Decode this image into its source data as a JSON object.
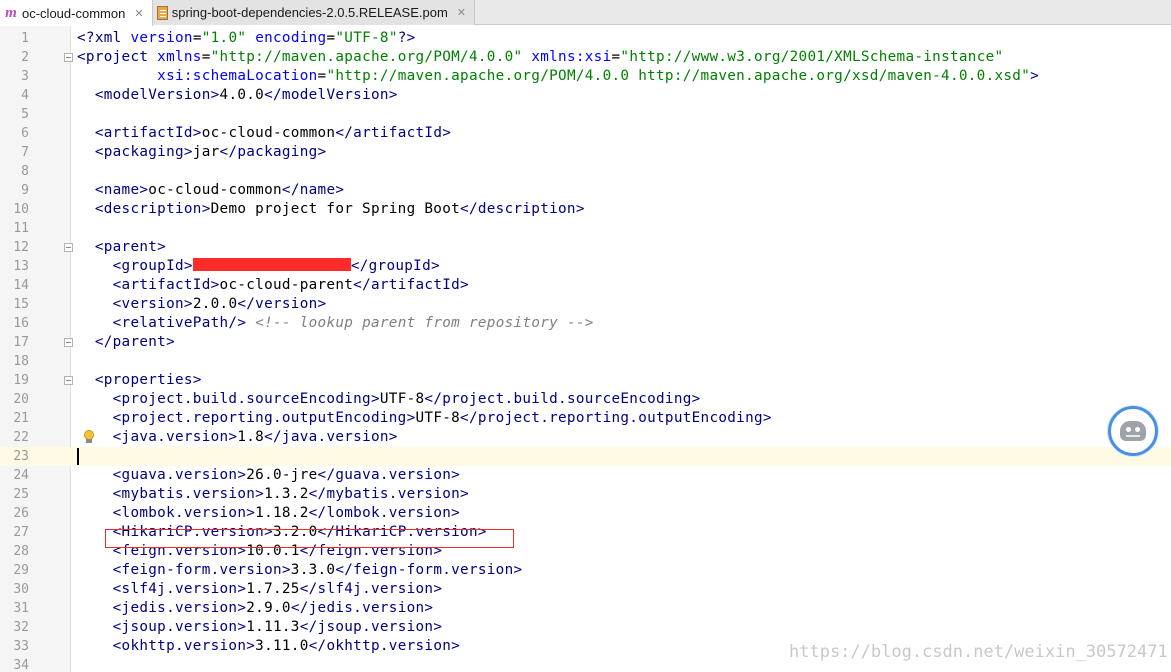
{
  "tabs": [
    {
      "label": "oc-cloud-common",
      "icon": "maven-module-icon",
      "active": true
    },
    {
      "label": "spring-boot-dependencies-2.0.5.RELEASE.pom",
      "icon": "pom-file-icon",
      "active": false
    }
  ],
  "editor": {
    "current_line": 23,
    "highlighted_line": 26,
    "lines": [
      {
        "n": "1",
        "parts": [
          [
            "tag",
            "<?xml "
          ],
          [
            "an",
            "version"
          ],
          [
            "",
            "="
          ],
          [
            "av",
            "\"1.0\""
          ],
          [
            "an",
            " encoding"
          ],
          [
            "",
            "="
          ],
          [
            "av",
            "\"UTF-8\""
          ],
          [
            "tag",
            "?>"
          ]
        ]
      },
      {
        "n": "2",
        "parts": [
          [
            "tag",
            "<project "
          ],
          [
            "an",
            "xmlns"
          ],
          [
            "",
            "="
          ],
          [
            "av",
            "\"http://maven.apache.org/POM/4.0.0\""
          ],
          [
            "an",
            " xmlns:xsi"
          ],
          [
            "",
            "="
          ],
          [
            "av",
            "\"http://www.w3.org/2001/XMLSchema-instance\""
          ]
        ]
      },
      {
        "n": "3",
        "parts": [
          [
            "",
            "         "
          ],
          [
            "an",
            "xsi:schemaLocation"
          ],
          [
            "",
            "="
          ],
          [
            "av",
            "\"http://maven.apache.org/POM/4.0.0 http://maven.apache.org/xsd/maven-4.0.0.xsd\""
          ],
          [
            "tag",
            ">"
          ]
        ]
      },
      {
        "n": "4",
        "parts": [
          [
            "",
            "  "
          ],
          [
            "tag",
            "<modelVersion>"
          ],
          [
            "",
            "4.0.0"
          ],
          [
            "tag",
            "</modelVersion>"
          ]
        ]
      },
      {
        "n": "5",
        "parts": []
      },
      {
        "n": "6",
        "parts": [
          [
            "",
            "  "
          ],
          [
            "tag",
            "<artifactId>"
          ],
          [
            "",
            "oc-cloud-common"
          ],
          [
            "tag",
            "</artifactId>"
          ]
        ]
      },
      {
        "n": "7",
        "parts": [
          [
            "",
            "  "
          ],
          [
            "tag",
            "<packaging>"
          ],
          [
            "",
            "jar"
          ],
          [
            "tag",
            "</packaging>"
          ]
        ]
      },
      {
        "n": "8",
        "parts": []
      },
      {
        "n": "9",
        "parts": [
          [
            "",
            "  "
          ],
          [
            "tag",
            "<name>"
          ],
          [
            "",
            "oc-cloud-common"
          ],
          [
            "tag",
            "</name>"
          ]
        ]
      },
      {
        "n": "10",
        "parts": [
          [
            "",
            "  "
          ],
          [
            "tag",
            "<description>"
          ],
          [
            "",
            "Demo project for Spring Boot"
          ],
          [
            "tag",
            "</description>"
          ]
        ]
      },
      {
        "n": "11",
        "parts": []
      },
      {
        "n": "12",
        "parts": [
          [
            "",
            "  "
          ],
          [
            "tag",
            "<parent>"
          ]
        ]
      },
      {
        "n": "13",
        "parts": [
          [
            "",
            "    "
          ],
          [
            "tag",
            "<groupId>"
          ],
          [
            "redact",
            ""
          ],
          [
            "tag",
            "</groupId>"
          ]
        ]
      },
      {
        "n": "14",
        "parts": [
          [
            "",
            "    "
          ],
          [
            "tag",
            "<artifactId>"
          ],
          [
            "",
            "oc-cloud-parent"
          ],
          [
            "tag",
            "</artifactId>"
          ]
        ]
      },
      {
        "n": "15",
        "parts": [
          [
            "",
            "    "
          ],
          [
            "tag",
            "<version>"
          ],
          [
            "",
            "2.0.0"
          ],
          [
            "tag",
            "</version>"
          ]
        ]
      },
      {
        "n": "16",
        "parts": [
          [
            "",
            "    "
          ],
          [
            "tag",
            "<relativePath/>"
          ],
          [
            "",
            " "
          ],
          [
            "cm",
            "<!-- lookup parent from repository -->"
          ]
        ]
      },
      {
        "n": "17",
        "parts": [
          [
            "",
            "  "
          ],
          [
            "tag",
            "</parent>"
          ]
        ]
      },
      {
        "n": "18",
        "parts": []
      },
      {
        "n": "19",
        "parts": [
          [
            "",
            "  "
          ],
          [
            "tag",
            "<properties>"
          ]
        ]
      },
      {
        "n": "20",
        "parts": [
          [
            "",
            "    "
          ],
          [
            "tag",
            "<project.build.sourceEncoding>"
          ],
          [
            "",
            "UTF-8"
          ],
          [
            "tag",
            "</project.build.sourceEncoding>"
          ]
        ]
      },
      {
        "n": "21",
        "parts": [
          [
            "",
            "    "
          ],
          [
            "tag",
            "<project.reporting.outputEncoding>"
          ],
          [
            "",
            "UTF-8"
          ],
          [
            "tag",
            "</project.reporting.outputEncoding>"
          ]
        ]
      },
      {
        "n": "22",
        "parts": [
          [
            "",
            "    "
          ],
          [
            "tag",
            "<java.version>"
          ],
          [
            "",
            "1.8"
          ],
          [
            "tag",
            "</java.version>"
          ]
        ]
      },
      {
        "n": "23",
        "parts": []
      },
      {
        "n": "24",
        "parts": [
          [
            "",
            "    "
          ],
          [
            "tag",
            "<guava.version>"
          ],
          [
            "",
            "26.0-jre"
          ],
          [
            "tag",
            "</guava.version>"
          ]
        ]
      },
      {
        "n": "25",
        "parts": [
          [
            "",
            "    "
          ],
          [
            "tag",
            "<mybatis.version>"
          ],
          [
            "",
            "1.3.2"
          ],
          [
            "tag",
            "</mybatis.version>"
          ]
        ]
      },
      {
        "n": "26",
        "parts": [
          [
            "",
            "    "
          ],
          [
            "tag",
            "<lombok.version>"
          ],
          [
            "",
            "1.18.2"
          ],
          [
            "tag",
            "</lombok.version>"
          ]
        ]
      },
      {
        "n": "27",
        "parts": [
          [
            "",
            "    "
          ],
          [
            "tag",
            "<HikariCP.version>"
          ],
          [
            "",
            "3.2.0"
          ],
          [
            "tag",
            "</HikariCP.version>"
          ]
        ]
      },
      {
        "n": "28",
        "parts": [
          [
            "",
            "    "
          ],
          [
            "tag",
            "<feign.version>"
          ],
          [
            "",
            "10.0.1"
          ],
          [
            "tag",
            "</feign.version>"
          ]
        ]
      },
      {
        "n": "29",
        "parts": [
          [
            "",
            "    "
          ],
          [
            "tag",
            "<feign-form.version>"
          ],
          [
            "",
            "3.3.0"
          ],
          [
            "tag",
            "</feign-form.version>"
          ]
        ]
      },
      {
        "n": "30",
        "parts": [
          [
            "",
            "    "
          ],
          [
            "tag",
            "<slf4j.version>"
          ],
          [
            "",
            "1.7.25"
          ],
          [
            "tag",
            "</slf4j.version>"
          ]
        ]
      },
      {
        "n": "31",
        "parts": [
          [
            "",
            "    "
          ],
          [
            "tag",
            "<jedis.version>"
          ],
          [
            "",
            "2.9.0"
          ],
          [
            "tag",
            "</jedis.version>"
          ]
        ]
      },
      {
        "n": "32",
        "parts": [
          [
            "",
            "    "
          ],
          [
            "tag",
            "<jsoup.version>"
          ],
          [
            "",
            "1.11.3"
          ],
          [
            "tag",
            "</jsoup.version>"
          ]
        ]
      },
      {
        "n": "33",
        "parts": [
          [
            "",
            "    "
          ],
          [
            "tag",
            "<okhttp.version>"
          ],
          [
            "",
            "3.11.0"
          ],
          [
            "tag",
            "</okhttp.version>"
          ]
        ]
      },
      {
        "n": "34",
        "parts": []
      }
    ],
    "fold_lines": [
      2,
      12,
      17,
      19
    ],
    "bulb_line": 22
  },
  "watermark": "https://blog.csdn.net/weixin_30572471"
}
